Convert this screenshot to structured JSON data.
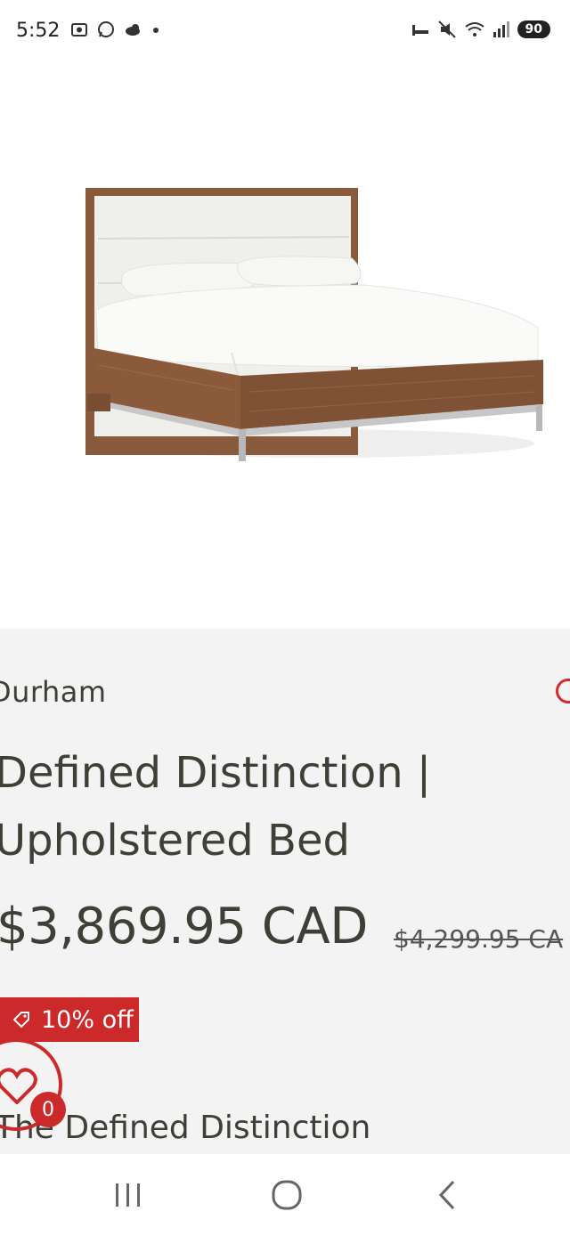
{
  "status_bar": {
    "time": "5:52",
    "battery": "90",
    "left_icons": [
      "screenshot-icon",
      "whatsapp-icon",
      "cloud-icon",
      "dot-icon"
    ],
    "right_icons": [
      "sleep-icon",
      "mute-icon",
      "wifi-icon",
      "signal-icon",
      "battery-icon"
    ]
  },
  "product": {
    "image": "bed-image",
    "brand": "Durham",
    "title": "Defined Distinction | Upholstered Bed",
    "price": "$3,869.95 CAD",
    "compare_price": "$4,299.95 CA",
    "discount_label": "10% off",
    "subtitle": "The Defined Distinction"
  },
  "wishlist": {
    "count": "0",
    "icon": "heart-icon"
  },
  "colors": {
    "accent": "#cc2a2a",
    "text": "#3f3f37",
    "panel_bg": "#f3f3f3"
  },
  "nav_bar": {
    "items": [
      "recent-apps-button",
      "home-button",
      "back-button"
    ]
  }
}
